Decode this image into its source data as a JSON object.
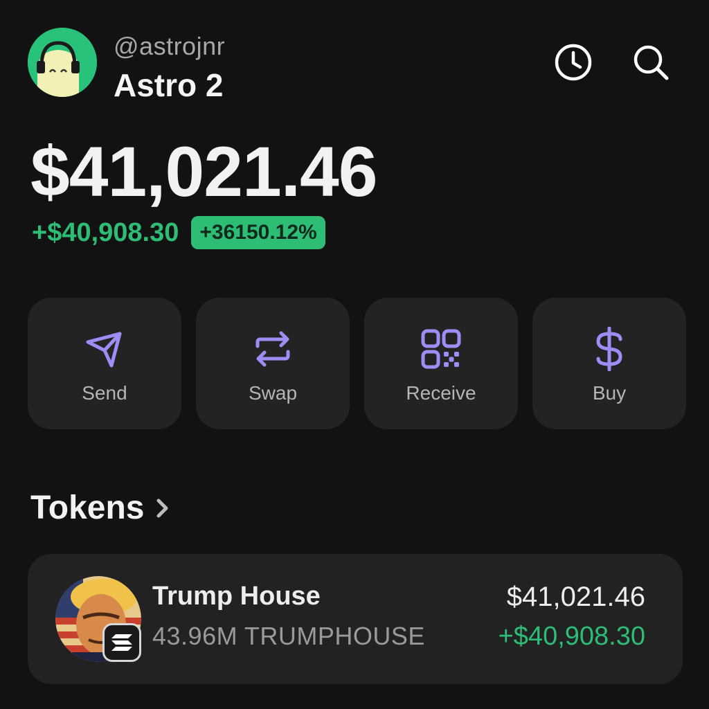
{
  "header": {
    "handle": "@astrojnr",
    "account_name": "Astro 2",
    "icons": [
      "history-icon",
      "search-icon"
    ]
  },
  "balance": {
    "total": "$41,021.46",
    "change_amount": "+$40,908.30",
    "change_percent": "+36150.12%"
  },
  "actions": [
    {
      "label": "Send",
      "icon": "send-icon"
    },
    {
      "label": "Swap",
      "icon": "swap-icon"
    },
    {
      "label": "Receive",
      "icon": "qr-code-icon"
    },
    {
      "label": "Buy",
      "icon": "dollar-icon"
    }
  ],
  "tokens": {
    "title": "Tokens",
    "items": [
      {
        "name": "Trump House",
        "amount": "43.96M TRUMPHOUSE",
        "value": "$41,021.46",
        "change": "+$40,908.30",
        "chain_icon": "solana-icon"
      }
    ]
  },
  "colors": {
    "background": "#121212",
    "card": "#232323",
    "accent": "#a08cf5",
    "positive": "#2ebd74",
    "avatar_bg": "#29c27a"
  }
}
